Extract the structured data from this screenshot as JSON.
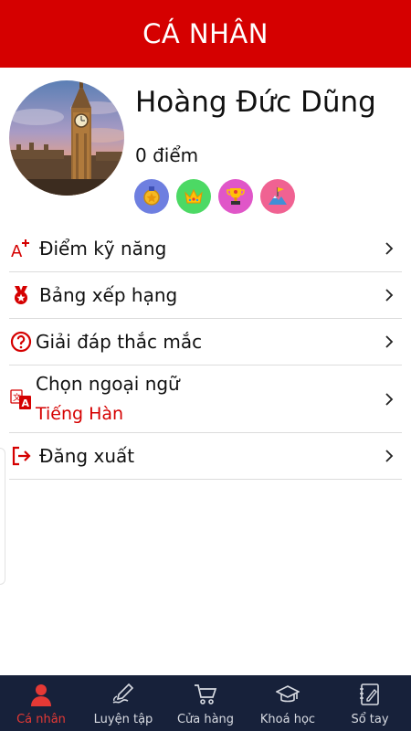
{
  "header": {
    "title": "CÁ NHÂN"
  },
  "profile": {
    "name": "Hoàng Đức Dũng",
    "points": "0 điểm",
    "badges": [
      {
        "icon": "medal-icon",
        "color": "#6e7fe0"
      },
      {
        "icon": "crown-icon",
        "color": "#4cd964"
      },
      {
        "icon": "trophy-icon",
        "color": "#e056c8"
      },
      {
        "icon": "flag-mountain-icon",
        "color": "#f06292"
      }
    ]
  },
  "menu": {
    "items": [
      {
        "label": "Điểm kỹ năng",
        "icon": "skill-score-icon"
      },
      {
        "label": "Bảng xếp hạng",
        "icon": "ranking-medal-icon"
      },
      {
        "label": "Giải đáp thắc mắc",
        "icon": "question-circle-icon"
      },
      {
        "label": "Chọn ngoại ngữ",
        "sub_label": "Tiếng Hàn",
        "icon": "translate-icon"
      },
      {
        "label": "Đăng xuất",
        "icon": "logout-icon"
      }
    ]
  },
  "bottom_nav": {
    "items": [
      {
        "label": "Cá nhân",
        "icon": "person-icon",
        "active": true
      },
      {
        "label": "Luyện tập",
        "icon": "writing-hand-icon"
      },
      {
        "label": "Cửa hàng",
        "icon": "cart-icon"
      },
      {
        "label": "Khoá học",
        "icon": "graduation-cap-icon"
      },
      {
        "label": "Sổ tay",
        "icon": "notebook-icon"
      }
    ]
  },
  "colors": {
    "primary": "#d50000",
    "nav_bg": "#17213a",
    "active": "#e53935"
  }
}
